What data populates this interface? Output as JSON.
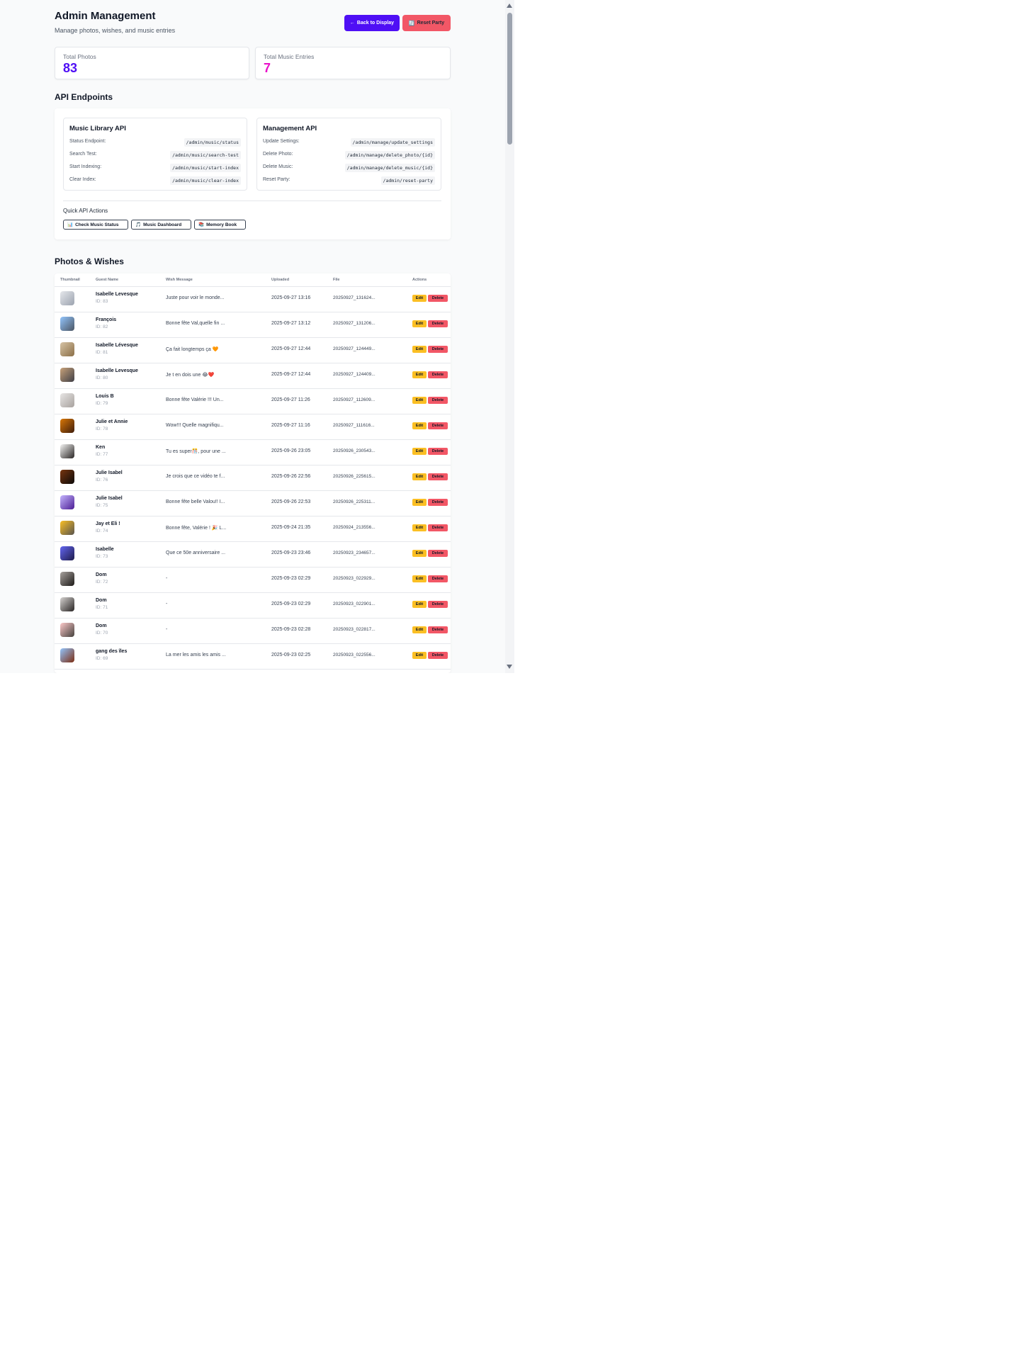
{
  "header": {
    "title": "Admin Management",
    "subtitle": "Manage photos, wishes, and music entries",
    "back_button": {
      "icon": "←",
      "label": "Back to Display"
    },
    "reset_button": {
      "icon": "🔄",
      "label": "Reset Party"
    }
  },
  "stats": {
    "photos": {
      "label": "Total Photos",
      "value": "83"
    },
    "music": {
      "label": "Total Music Entries",
      "value": "7"
    }
  },
  "api": {
    "section_title": "API Endpoints",
    "music": {
      "title": "Music Library API",
      "endpoints": [
        {
          "label": "Status Endpoint:",
          "path": "/admin/music/status"
        },
        {
          "label": "Search Test:",
          "path": "/admin/music/search-test"
        },
        {
          "label": "Start Indexing:",
          "path": "/admin/music/start-index"
        },
        {
          "label": "Clear Index:",
          "path": "/admin/music/clear-index"
        }
      ]
    },
    "management": {
      "title": "Management API",
      "endpoints": [
        {
          "label": "Update Settings:",
          "path": "/admin/manage/update_settings"
        },
        {
          "label": "Delete Photo:",
          "path": "/admin/manage/delete_photo/{id}"
        },
        {
          "label": "Delete Music:",
          "path": "/admin/manage/delete_music/{id}"
        },
        {
          "label": "Reset Party:",
          "path": "/admin/reset-party"
        }
      ]
    },
    "quick_actions": {
      "title": "Quick API Actions",
      "buttons": [
        {
          "icon": "📊",
          "label": "Check Music Status"
        },
        {
          "icon": "🎵",
          "label": "Music Dashboard"
        },
        {
          "icon": "📚",
          "label": "Memory Book"
        }
      ]
    }
  },
  "photos": {
    "section_title": "Photos & Wishes",
    "columns": [
      "Thumbnail",
      "Guest Name",
      "Wish Message",
      "Uploaded",
      "File",
      "Actions"
    ],
    "edit_label": "Edit",
    "delete_label": "Delete",
    "rows": [
      {
        "guest": "Isabelle Levesque",
        "id": "ID: 83",
        "wish": "Juste pour voir le monde...",
        "uploaded": "2025-09-27 13:16",
        "file": "20250927_131624...",
        "thumb_colors": [
          "#e5e7eb",
          "#9ca3af"
        ]
      },
      {
        "guest": "François",
        "id": "ID: 82",
        "wish": "Bonne fête Val,quelle fin ...",
        "uploaded": "2025-09-27 13:12",
        "file": "20250927_131206...",
        "thumb_colors": [
          "#93c5fd",
          "#4b5563"
        ]
      },
      {
        "guest": "Isabelle Lévesque",
        "id": "ID: 81",
        "wish": "Ça fait longtemps ça 🧡",
        "uploaded": "2025-09-27 12:44",
        "file": "20250927_124449...",
        "thumb_colors": [
          "#d6c3a5",
          "#8b6f47"
        ]
      },
      {
        "guest": "Isabelle Levesque",
        "id": "ID: 80",
        "wish": "Je t en dois une 😂❤️",
        "uploaded": "2025-09-27 12:44",
        "file": "20250927_124409...",
        "thumb_colors": [
          "#c8a27a",
          "#3f3f46"
        ]
      },
      {
        "guest": "Louis B",
        "id": "ID: 79",
        "wish": "Bonne fête Valérie !!! Un...",
        "uploaded": "2025-09-27 11:26",
        "file": "20250927_112609...",
        "thumb_colors": [
          "#e7e5e4",
          "#a8a29e"
        ]
      },
      {
        "guest": "Julie et Annie",
        "id": "ID: 78",
        "wish": "Wow!!! Quelle magnifiqu...",
        "uploaded": "2025-09-27 11:16",
        "file": "20250927_111616...",
        "thumb_colors": [
          "#d97706",
          "#3f1d0b"
        ]
      },
      {
        "guest": "Ken",
        "id": "ID: 77",
        "wish": "Tu es super🎊, pour une ...",
        "uploaded": "2025-09-26 23:05",
        "file": "20250926_230543...",
        "thumb_colors": [
          "#f5f5f4",
          "#292524"
        ]
      },
      {
        "guest": "Julie Isabel",
        "id": "ID: 76",
        "wish": "Je crois que ce vidéo te f...",
        "uploaded": "2025-09-26 22:56",
        "file": "20250926_225615...",
        "thumb_colors": [
          "#78350f",
          "#0c0a09"
        ]
      },
      {
        "guest": "Julie Isabel",
        "id": "ID: 75",
        "wish": "Bonne fête belle Valou!! I...",
        "uploaded": "2025-09-26 22:53",
        "file": "20250926_225311...",
        "thumb_colors": [
          "#c4b5fd",
          "#4c1d95"
        ]
      },
      {
        "guest": "Jay et Eli !",
        "id": "ID: 74",
        "wish": "Bonne fête, Valérie ! 🎉 L...",
        "uploaded": "2025-09-24 21:35",
        "file": "20250924_213556...",
        "thumb_colors": [
          "#fbbf24",
          "#57534e"
        ]
      },
      {
        "guest": "Isabelle",
        "id": "ID: 73",
        "wish": "Que ce 50e anniversaire ...",
        "uploaded": "2025-09-23 23:46",
        "file": "20250923_234657...",
        "thumb_colors": [
          "#6366f1",
          "#1e1b4b"
        ]
      },
      {
        "guest": "Dom",
        "id": "ID: 72",
        "wish": "-",
        "uploaded": "2025-09-23 02:29",
        "file": "20250923_022929...",
        "thumb_colors": [
          "#a8a29e",
          "#1c1917"
        ]
      },
      {
        "guest": "Dom",
        "id": "ID: 71",
        "wish": "-",
        "uploaded": "2025-09-23 02:29",
        "file": "20250923_022901...",
        "thumb_colors": [
          "#d6d3d1",
          "#292524"
        ]
      },
      {
        "guest": "Dom",
        "id": "ID: 70",
        "wish": "-",
        "uploaded": "2025-09-23 02:28",
        "file": "20250923_022817...",
        "thumb_colors": [
          "#fecaca",
          "#44403c"
        ]
      },
      {
        "guest": "gang des îles",
        "id": "ID: 69",
        "wish": "La mer les amis les amis ...",
        "uploaded": "2025-09-23 02:25",
        "file": "20250923_022556...",
        "thumb_colors": [
          "#93c5fd",
          "#7c2d12"
        ]
      }
    ]
  }
}
